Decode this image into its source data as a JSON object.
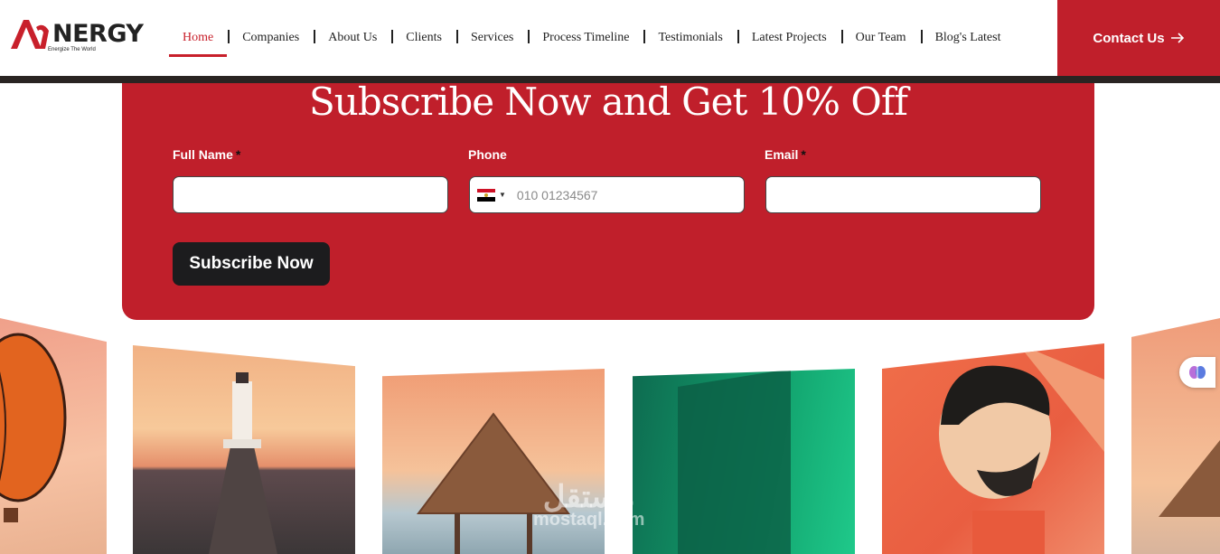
{
  "header": {
    "logo_text": "NERGY",
    "logo_tagline": "Energize The World",
    "nav": [
      {
        "label": "Home",
        "active": true
      },
      {
        "label": "Companies"
      },
      {
        "label": "About Us"
      },
      {
        "label": "Clients"
      },
      {
        "label": "Services"
      },
      {
        "label": "Process Timeline"
      },
      {
        "label": "Testimonials"
      },
      {
        "label": "Latest Projects"
      },
      {
        "label": "Our Team"
      },
      {
        "label": "Blog's Latest"
      }
    ],
    "contact_label": "Contact Us",
    "contact_icon": "arrow-right-icon"
  },
  "subscribe": {
    "title": "Subscribe Now and Get 10% Off",
    "fields": {
      "name_label": "Full Name",
      "phone_label": "Phone",
      "email_label": "Email",
      "required_mark": "*",
      "name_value": "",
      "email_value": "",
      "phone_placeholder": "010 01234567",
      "phone_country_icon": "egypt-flag-icon"
    },
    "button_label": "Subscribe Now"
  },
  "gallery": {
    "items": [
      {
        "name": "hot-air-balloon-image"
      },
      {
        "name": "lighthouse-pier-image"
      },
      {
        "name": "beach-hut-image"
      },
      {
        "name": "green-building-image"
      },
      {
        "name": "bearded-man-illustration"
      },
      {
        "name": "beach-hut-image-partial"
      }
    ]
  },
  "watermark": {
    "arabic": "مستقل",
    "latin": "mostaql.com"
  },
  "colors": {
    "brand_red": "#c01f2b",
    "dark": "#1c1c1e",
    "active_nav": "#c8202b"
  }
}
